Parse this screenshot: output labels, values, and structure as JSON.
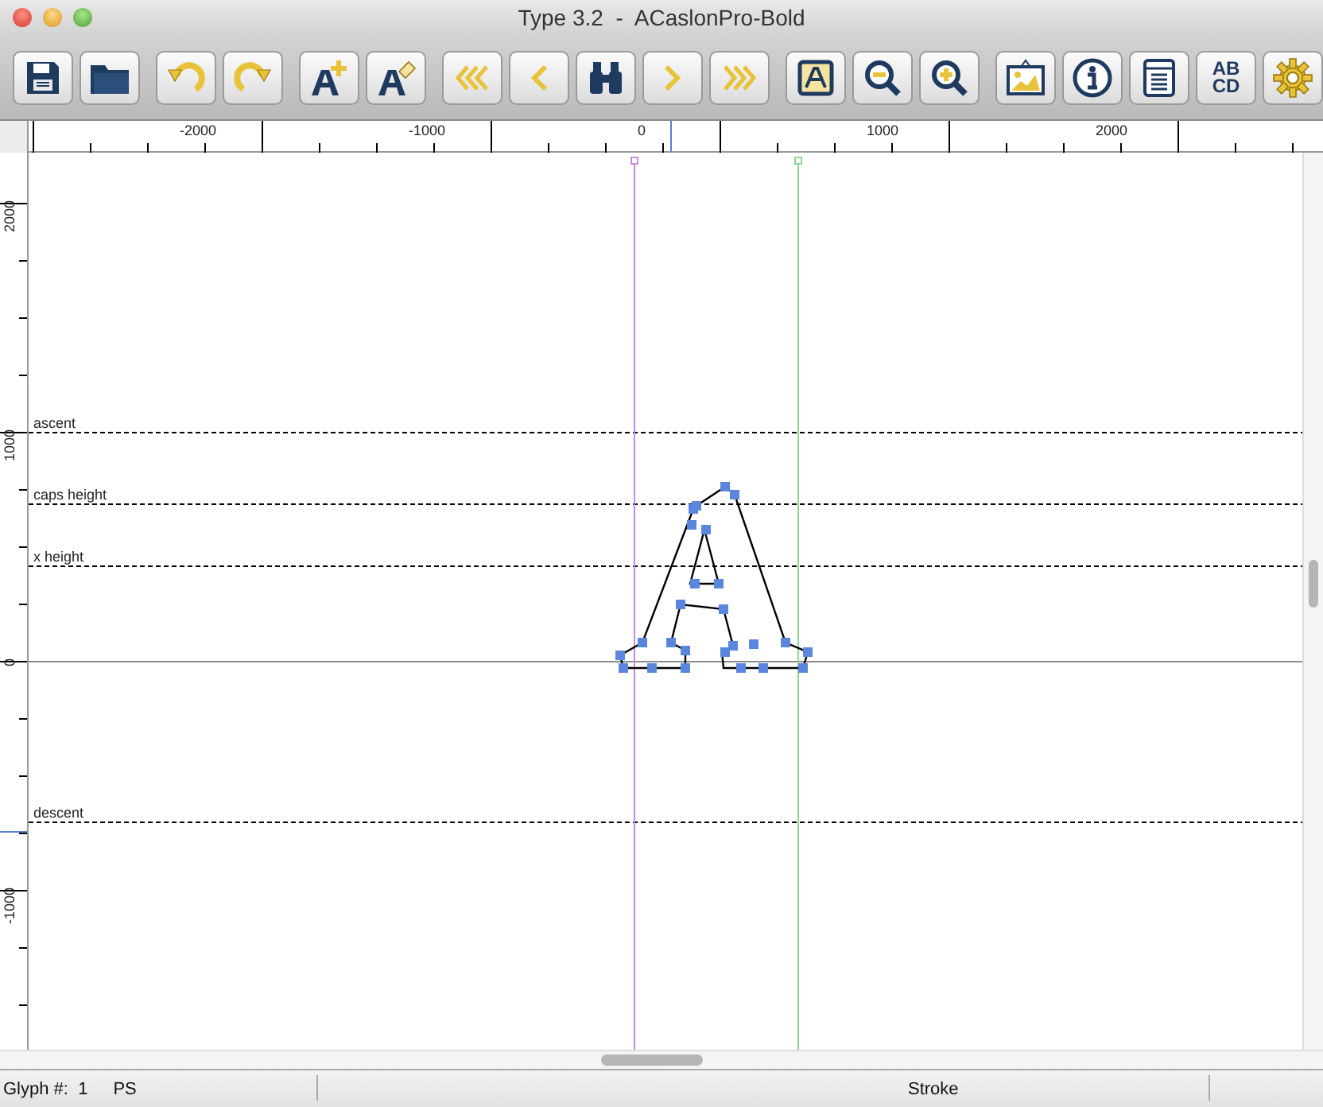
{
  "window": {
    "title": "Type 3.2  -  ACaslonPro-Bold"
  },
  "toolbar": [
    {
      "kind": "save"
    },
    {
      "kind": "open"
    },
    {
      "kind": "undo"
    },
    {
      "kind": "redo"
    },
    {
      "kind": "add_glyph"
    },
    {
      "kind": "edit_glyph"
    },
    {
      "kind": "first"
    },
    {
      "kind": "previous"
    },
    {
      "kind": "find"
    },
    {
      "kind": "next"
    },
    {
      "kind": "last"
    },
    {
      "kind": "glyph_view"
    },
    {
      "kind": "zoom_out"
    },
    {
      "kind": "zoom_in"
    },
    {
      "kind": "image"
    },
    {
      "kind": "info"
    },
    {
      "kind": "list"
    },
    {
      "kind": "text",
      "text": "AB CD"
    },
    {
      "kind": "settings"
    }
  ],
  "horizontal_ruler": {
    "labels": [
      "-2000",
      "-1000",
      "0",
      "1000",
      "2000"
    ]
  },
  "vertical_ruler": {
    "labels": [
      "2000",
      "1000",
      "0",
      "-1000"
    ]
  },
  "canvas": {
    "metric_lines": [
      {
        "label": "ascent"
      },
      {
        "label": "caps height"
      },
      {
        "label": "x height"
      },
      {
        "label": "descent"
      }
    ]
  },
  "status_bar": {
    "glyph": "Glyph #:  1",
    "mode": "PS",
    "field_3": "Stroke"
  }
}
